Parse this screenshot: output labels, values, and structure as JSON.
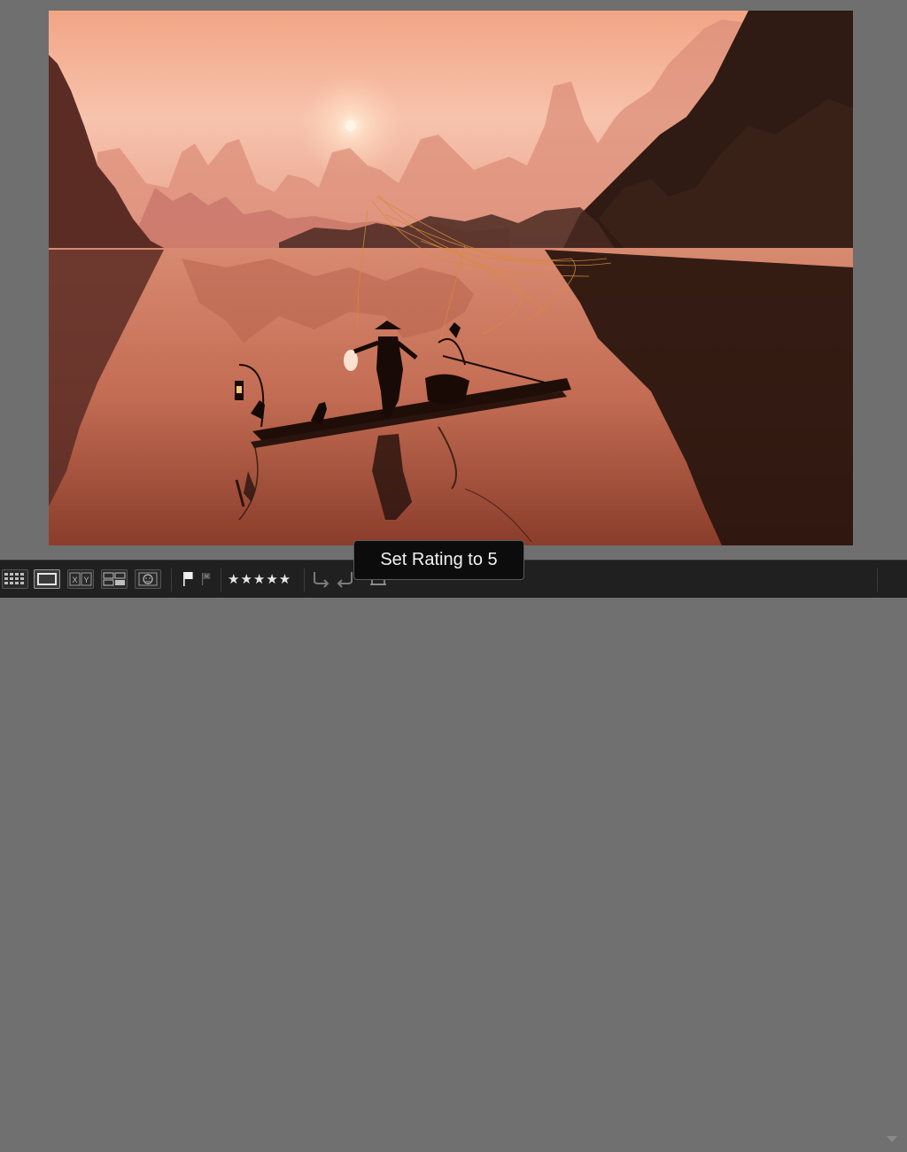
{
  "photo": {
    "description_icon": "cormorant-fisherman-photo"
  },
  "toolbar": {
    "views": [
      {
        "icon": "grid-view-icon",
        "active": false
      },
      {
        "icon": "loupe-view-icon",
        "active": true
      },
      {
        "icon": "compare-view-icon",
        "label": "XY",
        "active": false
      },
      {
        "icon": "survey-view-icon",
        "active": false
      },
      {
        "icon": "people-view-icon",
        "active": false
      }
    ],
    "flag_icon": "pick-flag-icon",
    "reject_icon": "reject-flag-icon",
    "rating_stars": "★★★★★",
    "rotate_left_icon": "rotate-left-icon",
    "rotate_right_icon": "rotate-right-icon",
    "extra_icon": "crop-overlay-icon",
    "dropdown_icon": "chevron-down-icon"
  },
  "tooltip": {
    "text": "Set Rating to 5"
  },
  "colors": {
    "canvas_bg": "#6f6f6f",
    "toolbar_bg": "#202020",
    "tooltip_bg": "#0c0c0c",
    "sky": "#f4b09a",
    "sun": "#fff0d8"
  }
}
